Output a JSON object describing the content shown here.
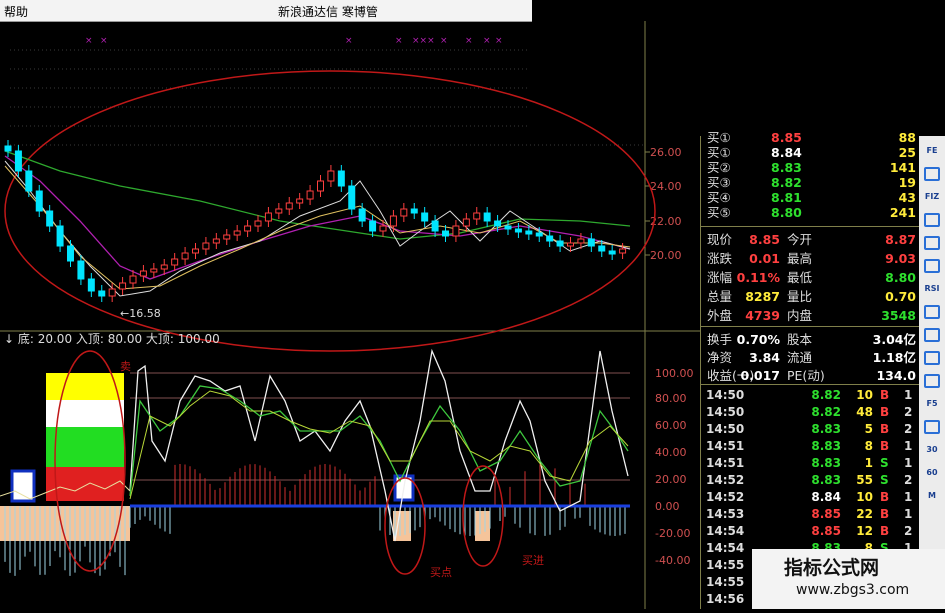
{
  "titlebar": {
    "menu": "帮助",
    "title": "新浪通达信  寒博管"
  },
  "price_chart": {
    "axis_ticks": [
      "26.00",
      "24.00",
      "22.00",
      "20.00"
    ],
    "low_label": "←16.58"
  },
  "indicator": {
    "header": "↓ 底: 20.00 入顶: 80.00 大顶: 100.00",
    "axis_ticks": [
      "100.00",
      "80.00",
      "60.00",
      "40.00",
      "20.00",
      "0.00",
      "-20.00",
      "-40.00"
    ],
    "annotations": {
      "buy_point": "买点",
      "buy_in": "买进",
      "top_mark": "卖"
    }
  },
  "quote": {
    "bids": [
      {
        "label": "买①",
        "price": "8.85",
        "vol": "88"
      },
      {
        "label": "买①",
        "price": "8.84",
        "vol": "25"
      },
      {
        "label": "买②",
        "price": "8.83",
        "vol": "141"
      },
      {
        "label": "买③",
        "price": "8.82",
        "vol": "19"
      },
      {
        "label": "买④",
        "price": "8.81",
        "vol": "43"
      },
      {
        "label": "买⑤",
        "price": "8.80",
        "vol": "241"
      }
    ],
    "stats": [
      {
        "l1": "现价",
        "v1": "8.85",
        "l2": "今开",
        "v2": "8.87"
      },
      {
        "l1": "涨跌",
        "v1": "0.01",
        "l2": "最高",
        "v2": "9.03"
      },
      {
        "l1": "涨幅",
        "v1": "0.11%",
        "l2": "最低",
        "v2": "8.80"
      },
      {
        "l1": "总量",
        "v1": "8287",
        "l2": "量比",
        "v2": "0.70"
      },
      {
        "l1": "外盘",
        "v1": "4739",
        "l2": "内盘",
        "v2": "3548"
      }
    ],
    "finance": [
      {
        "l1": "换手",
        "v1": "0.70%",
        "l2": "股本",
        "v2": "3.04亿"
      },
      {
        "l1": "净资",
        "v1": "3.84",
        "l2": "流通",
        "v2": "1.18亿"
      },
      {
        "l1": "收益(一)",
        "v1": "0.017",
        "l2": "PE(动)",
        "v2": "134.0"
      }
    ],
    "trades": [
      {
        "t": "14:50",
        "p": "8.82",
        "v": "10",
        "bs": "B",
        "n": "1"
      },
      {
        "t": "14:50",
        "p": "8.82",
        "v": "48",
        "bs": "B",
        "n": "2"
      },
      {
        "t": "14:50",
        "p": "8.83",
        "v": "5",
        "bs": "B",
        "n": "2"
      },
      {
        "t": "14:51",
        "p": "8.83",
        "v": "8",
        "bs": "B",
        "n": "1"
      },
      {
        "t": "14:51",
        "p": "8.83",
        "v": "1",
        "bs": "S",
        "n": "1"
      },
      {
        "t": "14:52",
        "p": "8.83",
        "v": "55",
        "bs": "S",
        "n": "2"
      },
      {
        "t": "14:52",
        "p": "8.84",
        "v": "10",
        "bs": "B",
        "n": "1"
      },
      {
        "t": "14:53",
        "p": "8.85",
        "v": "22",
        "bs": "B",
        "n": "1"
      },
      {
        "t": "14:54",
        "p": "8.85",
        "v": "12",
        "bs": "B",
        "n": "2"
      },
      {
        "t": "14:54",
        "p": "8.83",
        "v": "8",
        "bs": "S",
        "n": "1"
      },
      {
        "t": "14:55",
        "p": "",
        "v": "",
        "bs": "",
        "n": ""
      },
      {
        "t": "14:55",
        "p": "",
        "v": "",
        "bs": "",
        "n": ""
      },
      {
        "t": "14:56",
        "p": "",
        "v": "",
        "bs": "",
        "n": ""
      }
    ]
  },
  "toolbar": [
    "FE",
    "",
    "FIZ",
    "",
    "",
    "",
    "RSI",
    "",
    "",
    "",
    "",
    "F5",
    "",
    "30",
    "60",
    "M"
  ],
  "watermark": {
    "line1": "指标公式网",
    "line2": "www.zbgs3.com"
  },
  "colors": {
    "up": "#ff4040",
    "down": "#00e5ff",
    "panel_border": "#7f7f4a",
    "ma_green": "#2ea82e",
    "ma_purple": "#b020b0"
  }
}
